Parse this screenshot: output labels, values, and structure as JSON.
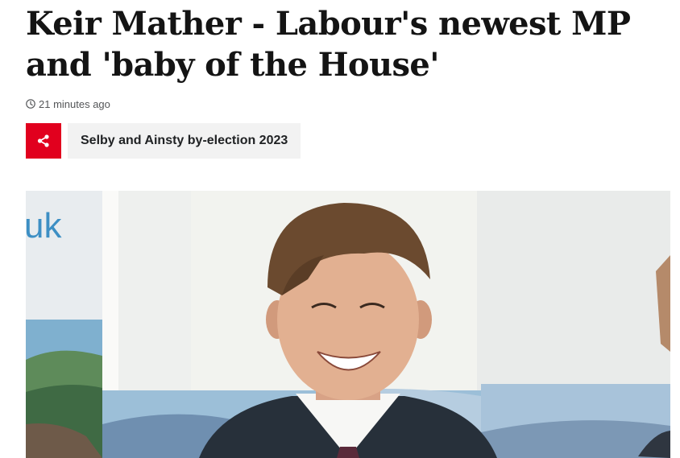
{
  "article": {
    "headline": "Keir Mather - Labour's newest MP and 'baby of the House'",
    "timestamp": "21 minutes ago",
    "share_icon": "share-icon",
    "topic_tag": "Selby and Ainsty by-election 2023"
  },
  "photo": {
    "backdrop_text": "uk"
  },
  "colors": {
    "accent": "#e1001e",
    "tag_background": "#f2f2f2",
    "headline": "#141414"
  }
}
